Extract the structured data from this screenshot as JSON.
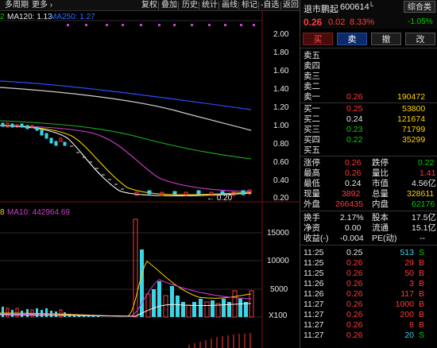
{
  "toolbar": {
    "period": "多周期",
    "more": "更多 ›",
    "buttons": [
      "复权",
      "叠加",
      "历史",
      "统计",
      "画线",
      "标记",
      "-自选",
      "返回"
    ]
  },
  "main_chart": {
    "ma_label_partial": "2",
    "ma120_label": "MA120: 1.13",
    "ma250_label": "MA250: 1.27",
    "low_marker": "← 0.20",
    "y_ticks": [
      "2.00",
      "1.80",
      "1.60",
      "1.40",
      "1.20",
      "1.00",
      "0.80",
      "0.60",
      "0.40",
      "0.20"
    ]
  },
  "volume_chart": {
    "label_prefix": "8",
    "ma10_label": "MA10: 442964.69",
    "y_ticks": [
      "15000",
      "10000",
      "5000"
    ],
    "unit": "X100"
  },
  "stock": {
    "name": "退市鹏起",
    "code": "600614",
    "suffix": "L",
    "price": "0.26",
    "change": "0.02",
    "change_pct": "8.33%",
    "index_name": "综合类",
    "index_change": "-1.05%"
  },
  "actions": [
    "买",
    "卖",
    "撤",
    "改"
  ],
  "order_book": {
    "sell": [
      {
        "label": "卖五",
        "price": "",
        "vol": ""
      },
      {
        "label": "卖四",
        "price": "",
        "vol": ""
      },
      {
        "label": "卖三",
        "price": "",
        "vol": ""
      },
      {
        "label": "卖二",
        "price": "",
        "vol": ""
      },
      {
        "label": "卖一",
        "price": "0.26",
        "vol": "190472"
      }
    ],
    "buy": [
      {
        "label": "买一",
        "price": "0.25",
        "vol": "53800"
      },
      {
        "label": "买二",
        "price": "0.24",
        "vol": "121674"
      },
      {
        "label": "买三",
        "price": "0.23",
        "vol": "71799"
      },
      {
        "label": "买四",
        "price": "0.22",
        "vol": "35299"
      },
      {
        "label": "买五",
        "price": "",
        "vol": ""
      }
    ]
  },
  "quote": [
    {
      "l1": "涨停",
      "v1": "0.26",
      "l2": "跌停",
      "v2": "0.22"
    },
    {
      "l1": "最高",
      "v1": "0.26",
      "l2": "量比",
      "v2": "1.41"
    },
    {
      "l1": "最低",
      "v1": "0.24",
      "l2": "市值",
      "v2": "4.56亿"
    },
    {
      "l1": "现量",
      "v1": "3892",
      "l2": "总量",
      "v2": "328611"
    },
    {
      "l1": "外盘",
      "v1": "266435",
      "l2": "内盘",
      "v2": "62176"
    }
  ],
  "stats": [
    {
      "l1": "换手",
      "v1": "2.17%",
      "l2": "股本",
      "v2": "17.5亿"
    },
    {
      "l1": "净资",
      "v1": "0.00",
      "l2": "流通",
      "v2": "15.1亿"
    },
    {
      "l1": "收益(-)",
      "v1": "-0.004",
      "l2": "PE(动)",
      "v2": "--"
    }
  ],
  "ticks": [
    {
      "time": "11:25",
      "price": "0.25",
      "vol": "513",
      "side": "S"
    },
    {
      "time": "11:25",
      "price": "0.26",
      "vol": "29",
      "side": "B"
    },
    {
      "time": "11:25",
      "price": "0.26",
      "vol": "50",
      "side": "B"
    },
    {
      "time": "11:26",
      "price": "0.26",
      "vol": "3",
      "side": "B"
    },
    {
      "time": "11:26",
      "price": "0.26",
      "vol": "117",
      "side": "B"
    },
    {
      "time": "11:27",
      "price": "0.26",
      "vol": "1000",
      "side": "B"
    },
    {
      "time": "11:27",
      "price": "0.26",
      "vol": "200",
      "side": "B"
    },
    {
      "time": "11:27",
      "price": "0.26",
      "vol": "8",
      "side": "B"
    },
    {
      "time": "11:27",
      "price": "0.26",
      "vol": "20",
      "side": "S"
    }
  ]
}
